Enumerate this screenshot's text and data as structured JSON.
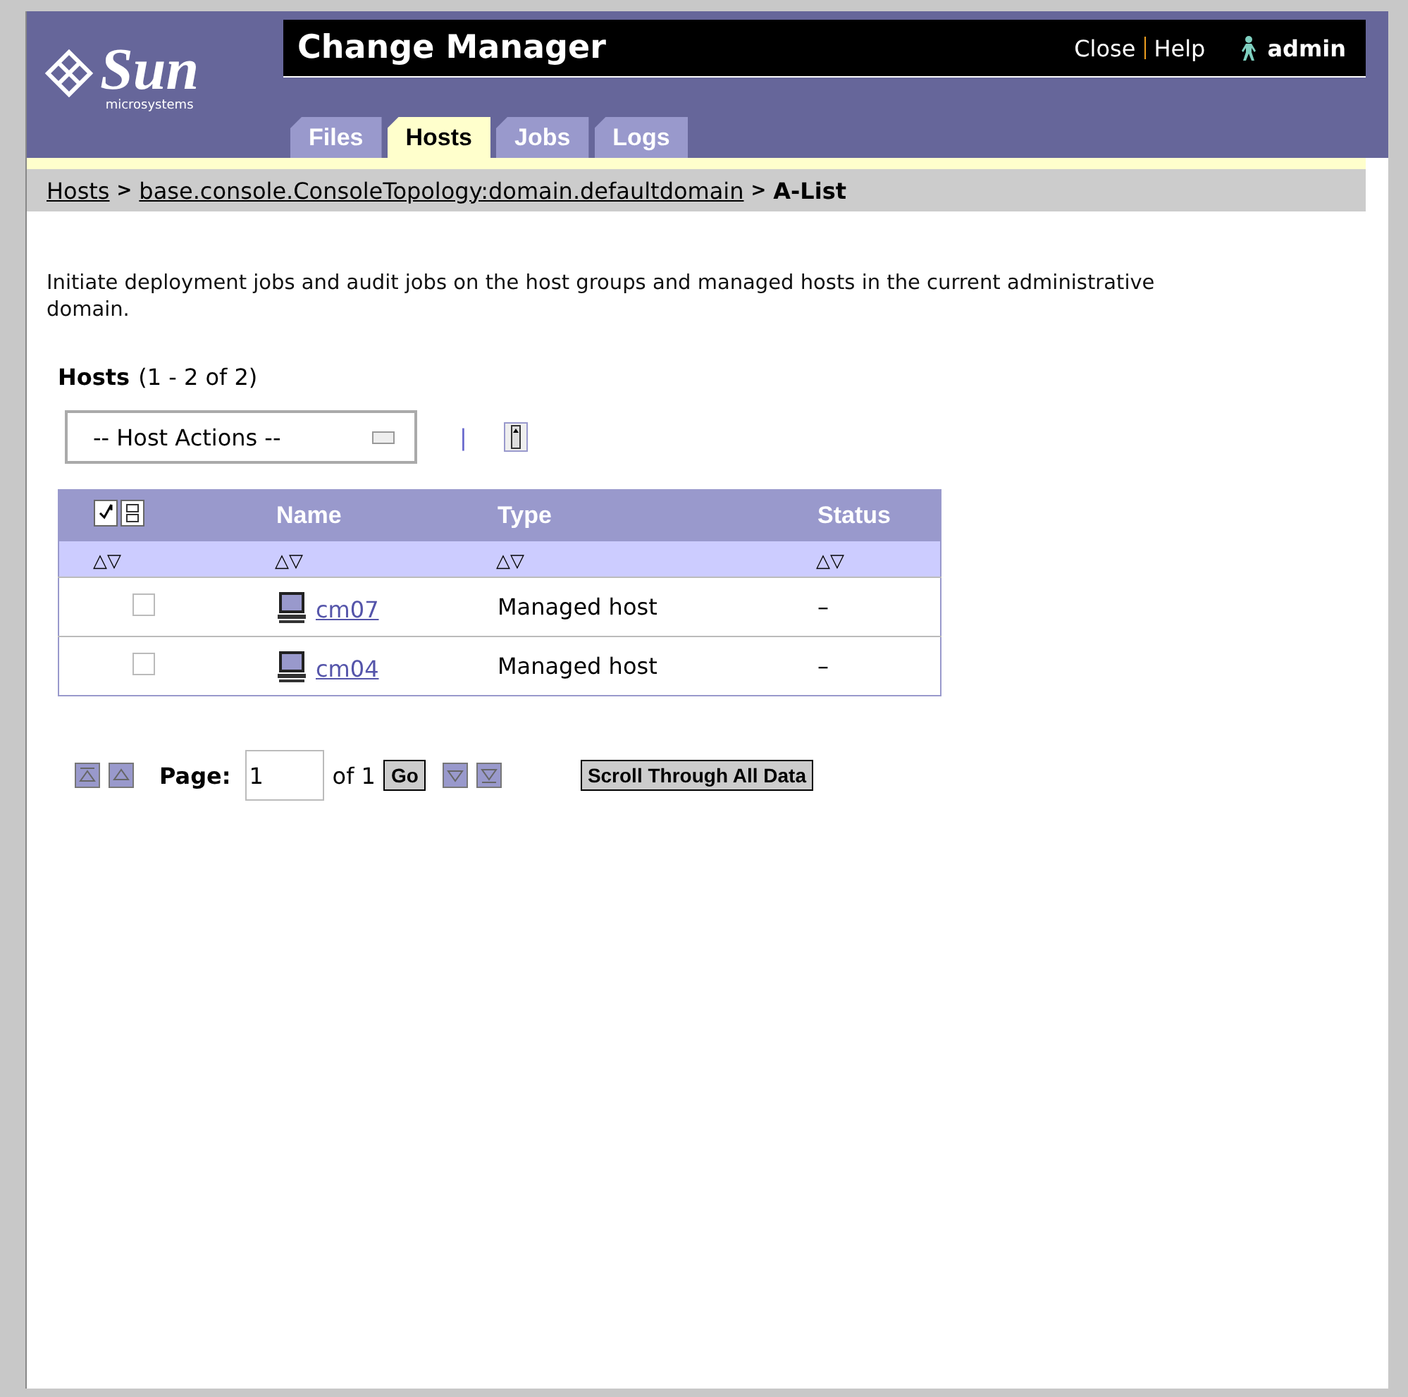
{
  "header": {
    "logo_text": "Sun",
    "logo_subtext": "microsystems",
    "title": "Change Manager",
    "links": [
      "Close",
      "Help"
    ],
    "user": "admin"
  },
  "tabs": [
    {
      "label": "Files",
      "selected": false
    },
    {
      "label": "Hosts",
      "selected": true
    },
    {
      "label": "Jobs",
      "selected": false
    },
    {
      "label": "Logs",
      "selected": false
    }
  ],
  "breadcrumb": {
    "links": [
      "Hosts",
      "base.console.ConsoleTopology:domain.defaultdomain"
    ],
    "separator": ">",
    "current": "A-List"
  },
  "description": "Initiate deployment jobs and audit jobs on the host groups and managed hosts in the current administrative domain.",
  "table_title": {
    "title": "Hosts",
    "count": "(1 - 2 of 2)"
  },
  "actions": {
    "dropdown": "-- Host Actions --",
    "separator": "|"
  },
  "table": {
    "columns": [
      "Name",
      "Type",
      "Status"
    ],
    "sort_arrows": "△▽",
    "rows": [
      {
        "name": "cm07",
        "type": "Managed host",
        "status": "–",
        "checked": false
      },
      {
        "name": "cm04",
        "type": "Managed host",
        "status": "–",
        "checked": false
      }
    ]
  },
  "pagination": {
    "label": "Page:",
    "value": "1",
    "of": "of 1",
    "go": "Go",
    "scroll_all": "Scroll Through All Data"
  }
}
